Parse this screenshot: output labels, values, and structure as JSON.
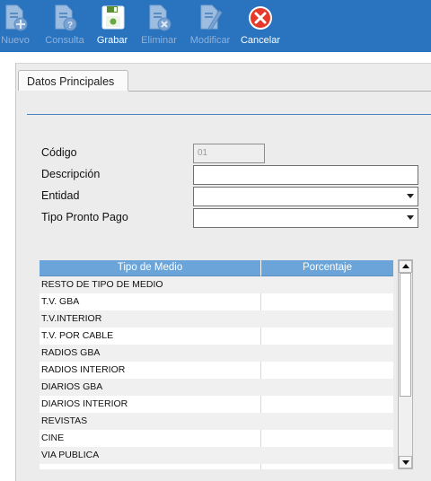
{
  "toolbar": {
    "nuevo": "Nuevo",
    "consulta": "Consulta",
    "grabar": "Grabar",
    "eliminar": "Eliminar",
    "modificar": "Modificar",
    "cancelar": "Cancelar"
  },
  "tab": {
    "label": "Datos Principales"
  },
  "form": {
    "codigo_label": "Código",
    "codigo_value": "01",
    "descripcion_label": "Descripción",
    "descripcion_value": "",
    "entidad_label": "Entidad",
    "entidad_value": "",
    "tipo_pronto_pago_label": "Tipo Pronto Pago",
    "tipo_pronto_pago_value": ""
  },
  "grid": {
    "columns": [
      "Tipo de Medio",
      "Porcentaje"
    ],
    "rows": [
      [
        "RESTO DE TIPO DE MEDIO",
        ""
      ],
      [
        "T.V. GBA",
        ""
      ],
      [
        "T.V.INTERIOR",
        ""
      ],
      [
        "T.V. POR CABLE",
        ""
      ],
      [
        "RADIOS GBA",
        ""
      ],
      [
        "RADIOS INTERIOR",
        ""
      ],
      [
        "DIARIOS GBA",
        ""
      ],
      [
        "DIARIOS INTERIOR",
        ""
      ],
      [
        "REVISTAS",
        ""
      ],
      [
        "CINE",
        ""
      ],
      [
        "VIA PUBLICA",
        ""
      ]
    ]
  },
  "colors": {
    "toolbar_bg": "#2a73bf",
    "grid_header": "#6aa4d8",
    "cancel_red": "#e53a2a",
    "section_line": "#4a7fc0"
  },
  "icons": {
    "nuevo": "new-document-icon",
    "consulta": "query-document-icon",
    "grabar": "save-disk-icon",
    "eliminar": "delete-document-icon",
    "modificar": "edit-document-icon",
    "cancelar": "cancel-icon"
  }
}
